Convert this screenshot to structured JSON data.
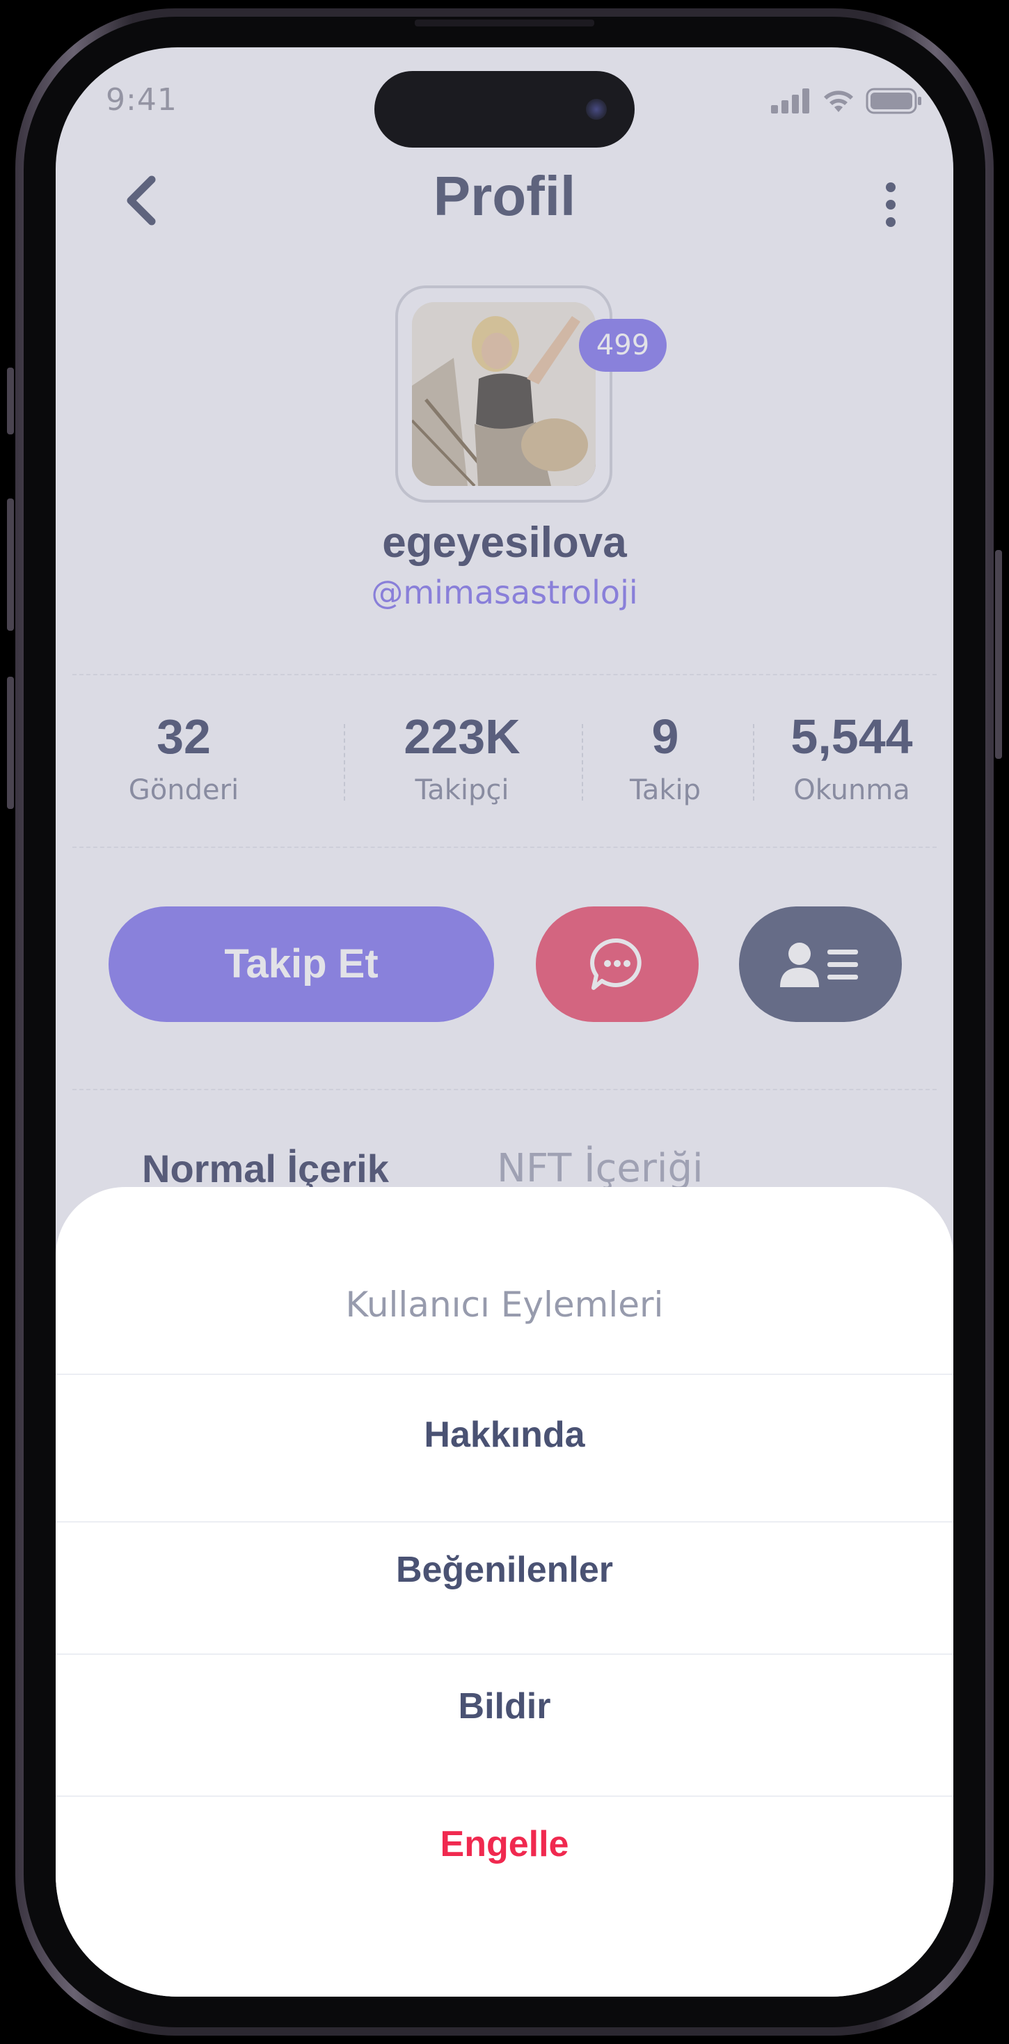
{
  "status_bar": {
    "time": "9:41"
  },
  "header": {
    "title": "Profil",
    "back_icon": "chevron-left-icon",
    "more_icon": "more-vertical-icon"
  },
  "profile": {
    "badge_count": "499",
    "username": "egeyesilova",
    "handle": "@mimasastroloji"
  },
  "stats": [
    {
      "value": "32",
      "label": "Gönderi"
    },
    {
      "value": "223K",
      "label": "Takipçi"
    },
    {
      "value": "9",
      "label": "Takip"
    },
    {
      "value": "5,544",
      "label": "Okunma"
    }
  ],
  "actions": {
    "follow_label": "Takip Et",
    "message_icon": "chat-bubble-icon",
    "profile_icon": "user-list-icon"
  },
  "tabs": [
    {
      "label": "Normal İçerik",
      "active": true
    },
    {
      "label": "NFT İçeriği",
      "active": false
    }
  ],
  "sheet": {
    "title": "Kullanıcı Eylemleri",
    "items": [
      {
        "label": "Hakkında"
      },
      {
        "label": "Beğenilenler"
      },
      {
        "label": "Bildir"
      },
      {
        "label": "Engelle",
        "danger": true
      }
    ]
  },
  "colors": {
    "accent": "#8e83f0",
    "message": "#ec5f7b",
    "profile_button": "#616885",
    "danger": "#f0294f",
    "text_dark": "#4a5273"
  }
}
